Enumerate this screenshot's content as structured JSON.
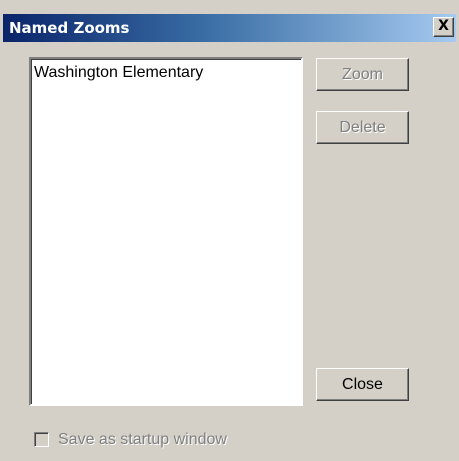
{
  "window": {
    "title": "Named Zooms",
    "close_glyph": "X"
  },
  "named_zooms_list": {
    "items": [
      {
        "label": "Washington Elementary"
      }
    ]
  },
  "buttons": {
    "zoom": {
      "label": "Zoom",
      "enabled": false
    },
    "delete": {
      "label": "Delete",
      "enabled": false
    },
    "close": {
      "label": "Close",
      "enabled": true
    }
  },
  "startup_option": {
    "label": "Save as startup window",
    "checked": false,
    "enabled": false
  },
  "colors": {
    "face": "#d4d0c8",
    "title_gradient_start": "#0a246a",
    "title_gradient_end": "#a6caf0",
    "disabled_text": "#808080"
  }
}
